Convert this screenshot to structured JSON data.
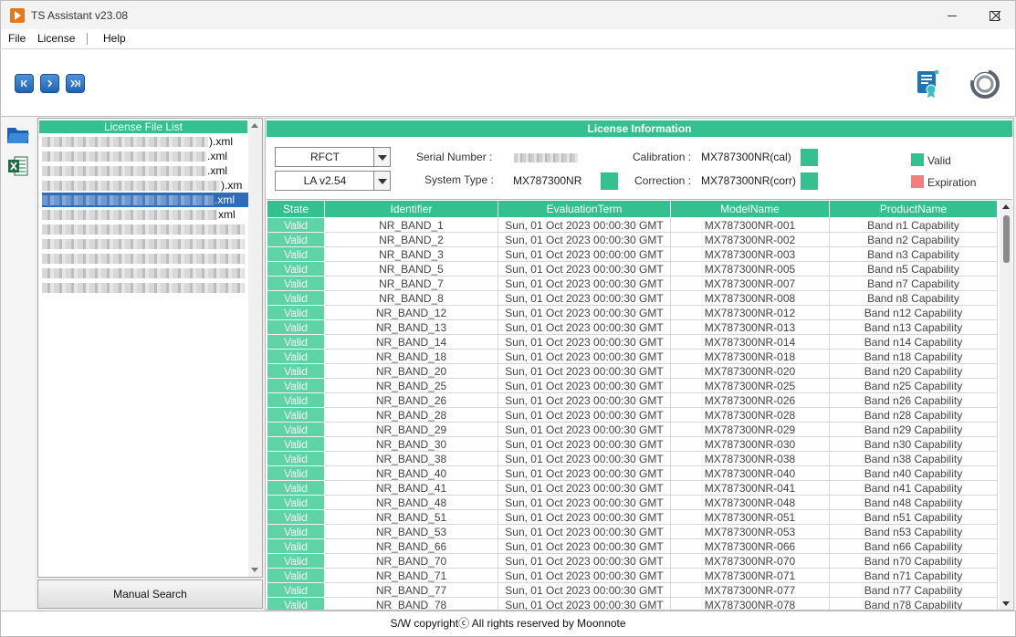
{
  "window": {
    "title": "TS Assistant v23.08"
  },
  "menu": {
    "file": "File",
    "license": "License",
    "help": "Help"
  },
  "left_panel": {
    "title": "License File List",
    "files": [
      {
        "suffix": ").xml",
        "selected": false
      },
      {
        "suffix": ".xml",
        "selected": false
      },
      {
        "suffix": ".xml",
        "selected": false
      },
      {
        "suffix": ").xm",
        "selected": false
      },
      {
        "suffix": ".xml",
        "selected": true
      },
      {
        "suffix": "xml",
        "selected": false
      },
      {
        "suffix": "",
        "selected": false
      },
      {
        "suffix": "",
        "selected": false
      },
      {
        "suffix": "",
        "selected": false
      },
      {
        "suffix": "",
        "selected": false
      },
      {
        "suffix": "",
        "selected": false
      }
    ],
    "manual_search": "Manual Search"
  },
  "license_info": {
    "title": "License Information",
    "combo1": "RFCT",
    "combo2": "LA v2.54",
    "serial_label": "Serial Number :",
    "system_label": "System Type :",
    "system_value": "MX787300NR",
    "calibration_label": "Calibration :",
    "calibration_value": "MX787300NR(cal)",
    "correction_label": "Correction :",
    "correction_value": "MX787300NR(corr)",
    "legend_valid": "Valid",
    "legend_expiration": "Expiration",
    "colors": {
      "valid": "#35c08f",
      "expiration": "#f08080",
      "state_cell": "#5ed3a6"
    }
  },
  "table": {
    "columns": [
      "State",
      "Identifier",
      "EvaluationTerm",
      "ModelName",
      "ProductName"
    ],
    "rows": [
      [
        "Valid",
        "NR_BAND_1",
        "Sun, 01 Oct 2023 00:00:30 GMT",
        "MX787300NR-001",
        "Band n1 Capability"
      ],
      [
        "Valid",
        "NR_BAND_2",
        "Sun, 01 Oct 2023 00:00:30 GMT",
        "MX787300NR-002",
        "Band n2 Capability"
      ],
      [
        "Valid",
        "NR_BAND_3",
        "Sun, 01 Oct 2023 00:00:00 GMT",
        "MX787300NR-003",
        "Band n3 Capability"
      ],
      [
        "Valid",
        "NR_BAND_5",
        "Sun, 01 Oct 2023 00:00:30 GMT",
        "MX787300NR-005",
        "Band n5 Capability"
      ],
      [
        "Valid",
        "NR_BAND_7",
        "Sun, 01 Oct 2023 00:00:30 GMT",
        "MX787300NR-007",
        "Band n7 Capability"
      ],
      [
        "Valid",
        "NR_BAND_8",
        "Sun, 01 Oct 2023 00:00:30 GMT",
        "MX787300NR-008",
        "Band n8 Capability"
      ],
      [
        "Valid",
        "NR_BAND_12",
        "Sun, 01 Oct 2023 00:00:30 GMT",
        "MX787300NR-012",
        "Band n12 Capability"
      ],
      [
        "Valid",
        "NR_BAND_13",
        "Sun, 01 Oct 2023 00:00:30 GMT",
        "MX787300NR-013",
        "Band n13 Capability"
      ],
      [
        "Valid",
        "NR_BAND_14",
        "Sun, 01 Oct 2023 00:00:30 GMT",
        "MX787300NR-014",
        "Band n14 Capability"
      ],
      [
        "Valid",
        "NR_BAND_18",
        "Sun, 01 Oct 2023 00:00:30 GMT",
        "MX787300NR-018",
        "Band n18 Capability"
      ],
      [
        "Valid",
        "NR_BAND_20",
        "Sun, 01 Oct 2023 00:00:30 GMT",
        "MX787300NR-020",
        "Band n20 Capability"
      ],
      [
        "Valid",
        "NR_BAND_25",
        "Sun, 01 Oct 2023 00:00:30 GMT",
        "MX787300NR-025",
        "Band n25 Capability"
      ],
      [
        "Valid",
        "NR_BAND_26",
        "Sun, 01 Oct 2023 00:00:30 GMT",
        "MX787300NR-026",
        "Band n26 Capability"
      ],
      [
        "Valid",
        "NR_BAND_28",
        "Sun, 01 Oct 2023 00:00:30 GMT",
        "MX787300NR-028",
        "Band n28 Capability"
      ],
      [
        "Valid",
        "NR_BAND_29",
        "Sun, 01 Oct 2023 00:00:30 GMT",
        "MX787300NR-029",
        "Band n29 Capability"
      ],
      [
        "Valid",
        "NR_BAND_30",
        "Sun, 01 Oct 2023 00:00:30 GMT",
        "MX787300NR-030",
        "Band n30 Capability"
      ],
      [
        "Valid",
        "NR_BAND_38",
        "Sun, 01 Oct 2023 00:00:30 GMT",
        "MX787300NR-038",
        "Band n38 Capability"
      ],
      [
        "Valid",
        "NR_BAND_40",
        "Sun, 01 Oct 2023 00:00:30 GMT",
        "MX787300NR-040",
        "Band n40 Capability"
      ],
      [
        "Valid",
        "NR_BAND_41",
        "Sun, 01 Oct 2023 00:00:30 GMT",
        "MX787300NR-041",
        "Band n41 Capability"
      ],
      [
        "Valid",
        "NR_BAND_48",
        "Sun, 01 Oct 2023 00:00:30 GMT",
        "MX787300NR-048",
        "Band n48 Capability"
      ],
      [
        "Valid",
        "NR_BAND_51",
        "Sun, 01 Oct 2023 00:00:30 GMT",
        "MX787300NR-051",
        "Band n51 Capability"
      ],
      [
        "Valid",
        "NR_BAND_53",
        "Sun, 01 Oct 2023 00:00:30 GMT",
        "MX787300NR-053",
        "Band n53 Capability"
      ],
      [
        "Valid",
        "NR_BAND_66",
        "Sun, 01 Oct 2023 00:00:30 GMT",
        "MX787300NR-066",
        "Band n66 Capability"
      ],
      [
        "Valid",
        "NR_BAND_70",
        "Sun, 01 Oct 2023 00:00:30 GMT",
        "MX787300NR-070",
        "Band n70 Capability"
      ],
      [
        "Valid",
        "NR_BAND_71",
        "Sun, 01 Oct 2023 00:00:30 GMT",
        "MX787300NR-071",
        "Band n71 Capability"
      ],
      [
        "Valid",
        "NR_BAND_77",
        "Sun, 01 Oct 2023 00:00:30 GMT",
        "MX787300NR-077",
        "Band n77 Capability"
      ],
      [
        "Valid",
        "NR_BAND_78",
        "Sun, 01 Oct 2023 00:00:30 GMT",
        "MX787300NR-078",
        "Band n78 Capability"
      ]
    ]
  },
  "statusbar": {
    "text": "S/W copyrightⓒ All rights reserved by Moonnote"
  }
}
